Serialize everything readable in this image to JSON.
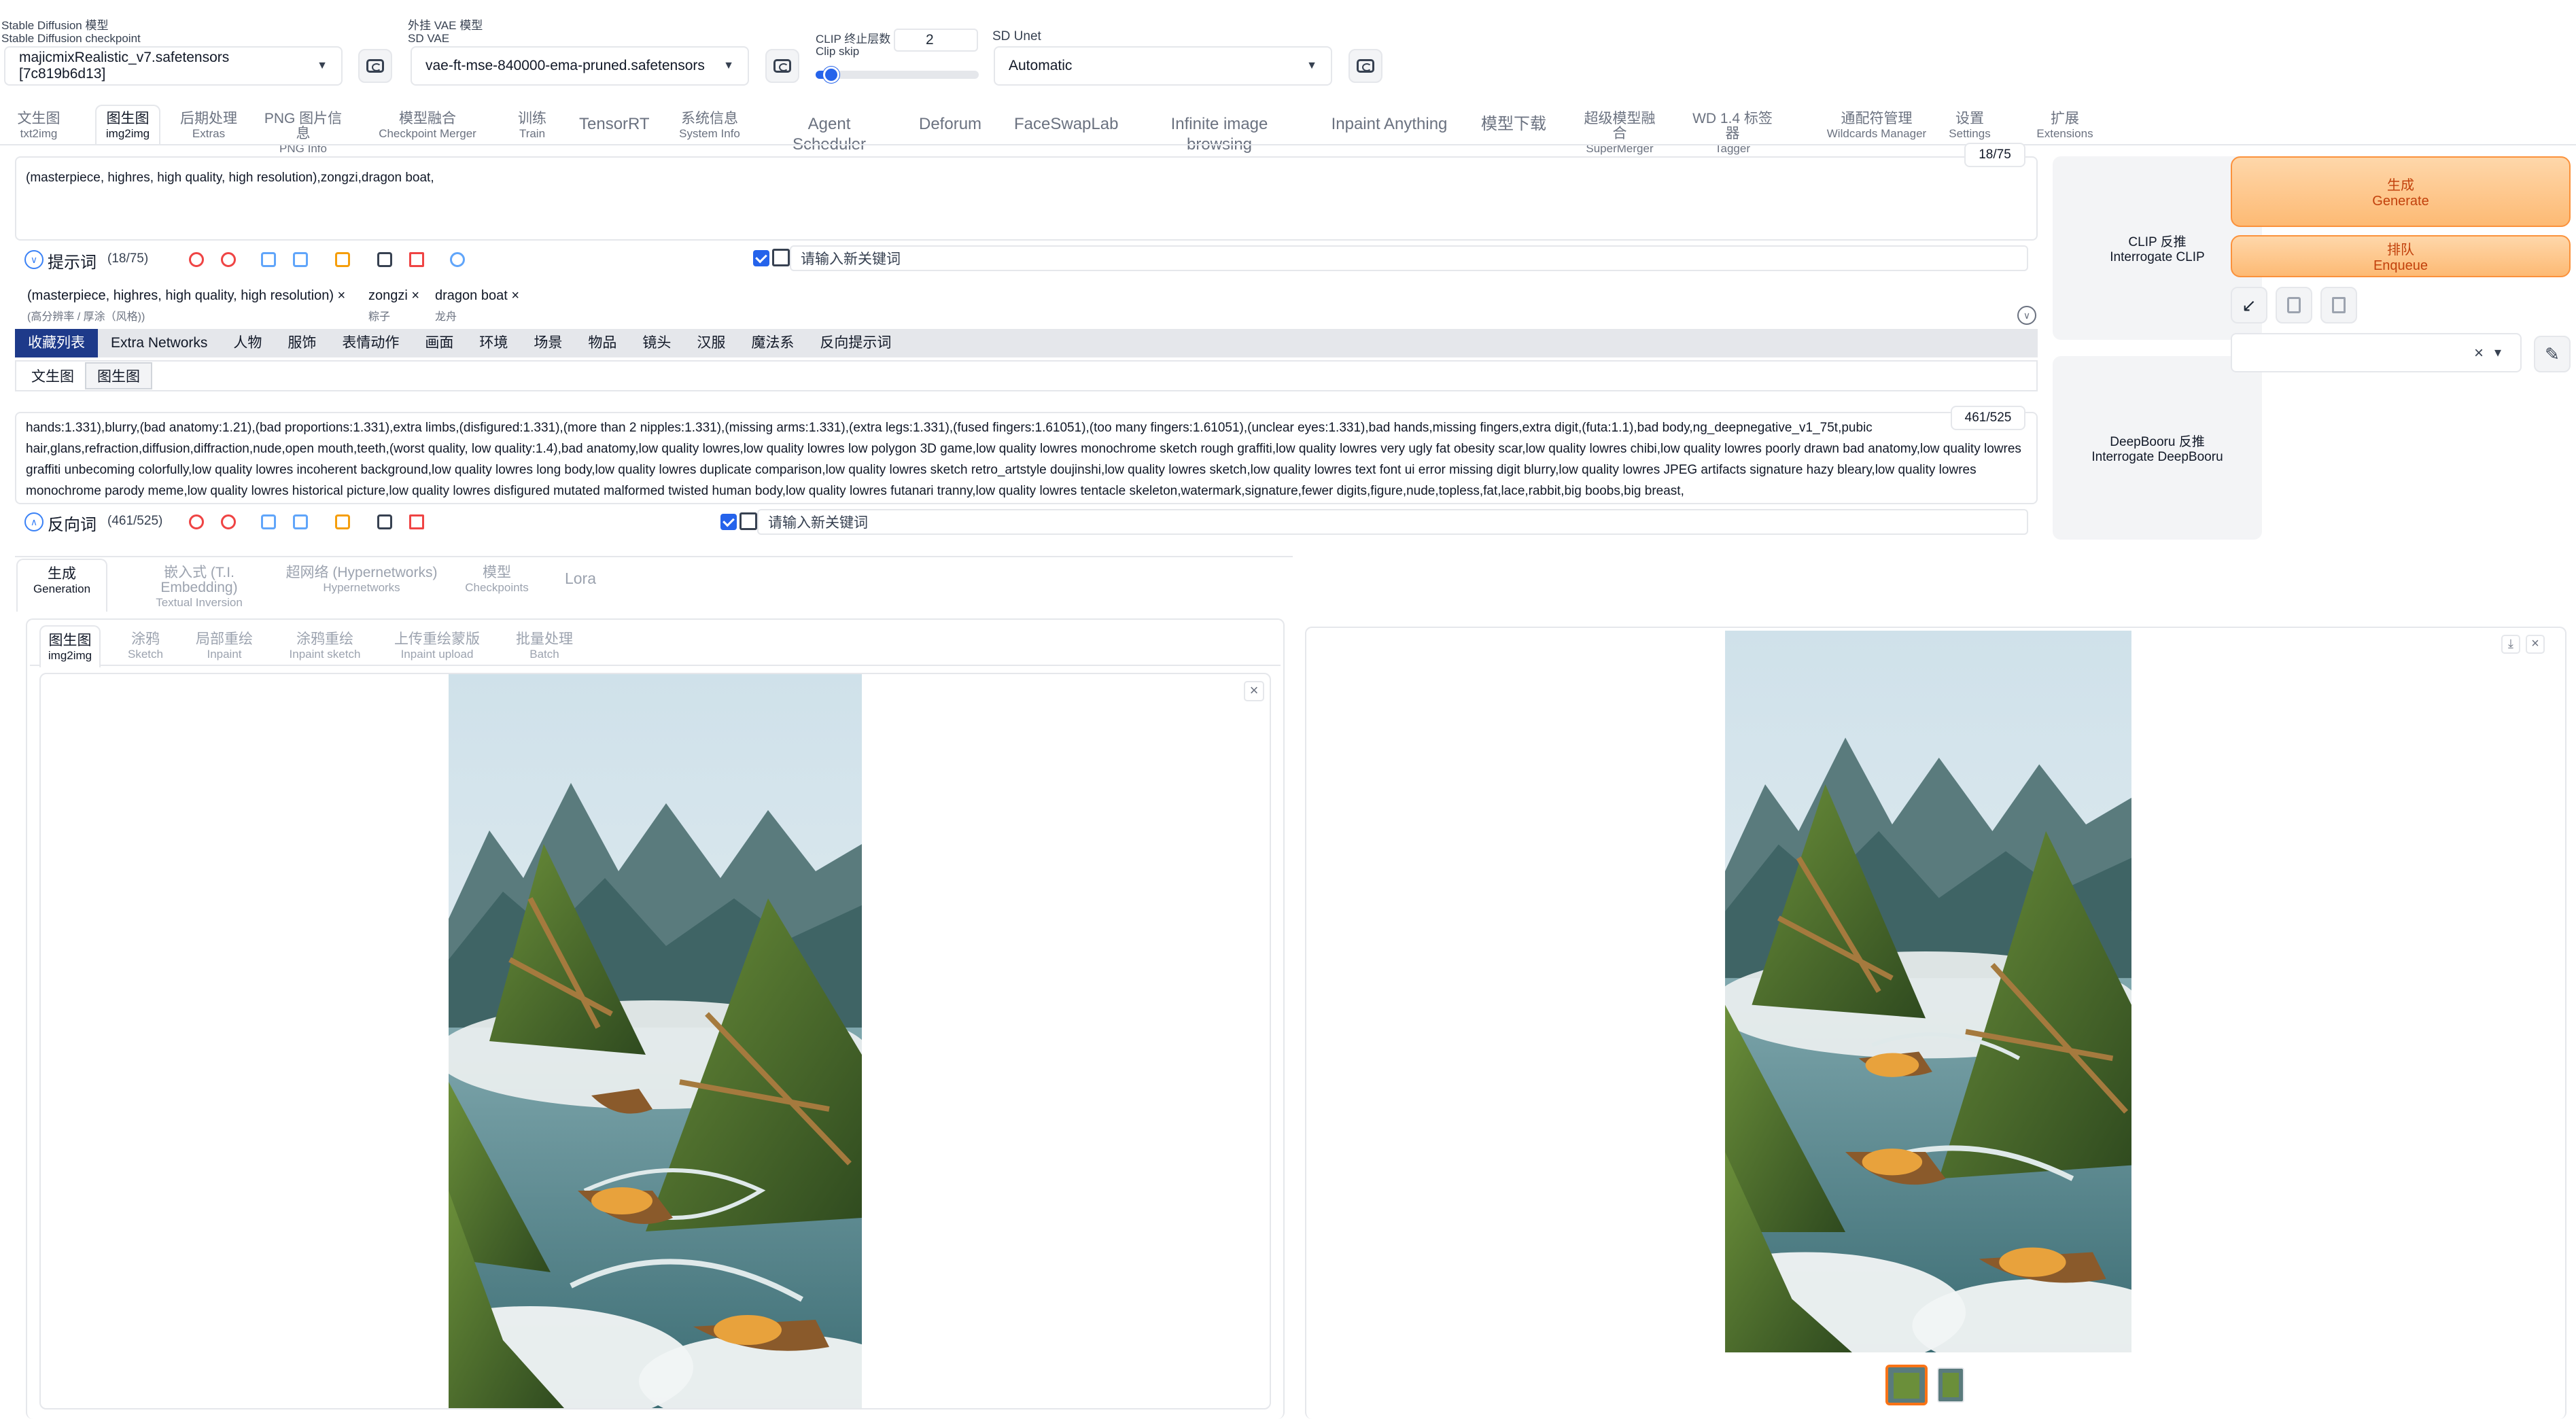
{
  "header": {
    "checkpoint": {
      "label_cn": "Stable Diffusion 模型",
      "label_en": "Stable Diffusion checkpoint",
      "value": "majicmixRealistic_v7.safetensors [7c819b6d13]"
    },
    "vae": {
      "label_cn": "外挂 VAE 模型",
      "label_en": "SD VAE",
      "value": "vae-ft-mse-840000-ema-pruned.safetensors"
    },
    "clip": {
      "label_cn": "CLIP 终止层数",
      "label_en": "Clip skip",
      "value": "2",
      "slider_fraction": 0.08
    },
    "unet": {
      "label": "SD Unet",
      "value": "Automatic"
    }
  },
  "tabs": [
    {
      "cn": "文生图",
      "en": "txt2img"
    },
    {
      "cn": "图生图",
      "en": "img2img"
    },
    {
      "cn": "后期处理",
      "en": "Extras"
    },
    {
      "cn": "PNG 图片信息",
      "en": "PNG Info"
    },
    {
      "cn": "模型融合",
      "en": "Checkpoint Merger"
    },
    {
      "cn": "训练",
      "en": "Train"
    },
    {
      "single": "TensorRT"
    },
    {
      "cn": "系统信息",
      "en": "System Info"
    },
    {
      "single": "Agent Scheduler"
    },
    {
      "single": "Deforum"
    },
    {
      "single": "FaceSwapLab"
    },
    {
      "single": "Infinite image browsing"
    },
    {
      "single": "Inpaint Anything"
    },
    {
      "single": "模型下载"
    },
    {
      "cn": "超级模型融合",
      "en": "SuperMerger"
    },
    {
      "cn": "WD 1.4 标签器",
      "en": "Tagger"
    },
    {
      "cn": "通配符管理",
      "en": "Wildcards Manager"
    },
    {
      "cn": "设置",
      "en": "Settings"
    },
    {
      "cn": "扩展",
      "en": "Extensions"
    }
  ],
  "prompt": {
    "text": "(masterpiece, highres, high quality, high resolution),zongzi,dragon boat,",
    "counter": "18/75",
    "label": "提示词",
    "count": "(18/75)",
    "keyword_placeholder": "请输入新关键词",
    "tags": [
      {
        "text": "(masterpiece, highres, high quality, high resolution)",
        "sub": "(高分辨率 / 厚涂（风格))"
      },
      {
        "text": "zongzi",
        "sub": "粽子"
      },
      {
        "text": "dragon boat",
        "sub": "龙舟"
      }
    ],
    "close_glyph": "×"
  },
  "categories": [
    "收藏列表",
    "Extra Networks",
    "人物",
    "服饰",
    "表情动作",
    "画面",
    "环境",
    "场景",
    "物品",
    "镜头",
    "汉服",
    "魔法系",
    "反向提示词"
  ],
  "subcategories": [
    "文生图",
    "图生图"
  ],
  "negative": {
    "text": "hands:1.331),blurry,(bad anatomy:1.21),(bad proportions:1.331),extra limbs,(disfigured:1.331),(more than 2 nipples:1.331),(missing arms:1.331),(extra legs:1.331),(fused fingers:1.61051),(too many fingers:1.61051),(unclear eyes:1.331),bad hands,missing fingers,extra digit,(futa:1.1),bad body,ng_deepnegative_v1_75t,pubic hair,glans,refraction,diffusion,diffraction,nude,open mouth,teeth,(worst quality, low quality:1.4),bad anatomy,low quality lowres,low quality lowres low polygon 3D game,low quality lowres monochrome sketch rough graffiti,low quality lowres very ugly fat obesity scar,low quality lowres chibi,low quality lowres poorly drawn bad anatomy,low quality lowres graffiti unbecoming colorfully,low quality lowres incoherent background,low quality lowres long body,low quality lowres duplicate comparison,low quality lowres sketch retro_artstyle doujinshi,low quality lowres sketch,low quality lowres text font ui error missing digit blurry,low quality lowres JPEG artifacts signature hazy bleary,low quality lowres monochrome parody meme,low quality lowres historical picture,low quality lowres disfigured mutated malformed twisted human body,low quality lowres futanari tranny,low quality lowres tentacle skeleton,watermark,signature,fewer digits,figure,nude,topless,fat,lace,rabbit,big boobs,big breast,",
    "counter": "461/525",
    "label": "反向词",
    "count": "(461/525)",
    "keyword_placeholder": "请输入新关键词"
  },
  "side": {
    "clip_cn": "CLIP 反推",
    "clip_en": "Interrogate CLIP",
    "deepbooru_cn": "DeepBooru 反推",
    "deepbooru_en": "Interrogate DeepBooru",
    "generate_cn": "生成",
    "generate_en": "Generate",
    "enqueue_cn": "排队",
    "enqueue_en": "Enqueue",
    "clear_glyph": "×",
    "dropdown_glyph": "▾"
  },
  "settings_tabs": [
    {
      "cn": "生成",
      "en": "Generation"
    },
    {
      "cn": "嵌入式 (T.I. Embedding)",
      "en": "Textual Inversion"
    },
    {
      "cn": "超网络 (Hypernetworks)",
      "en": "Hypernetworks"
    },
    {
      "cn": "模型",
      "en": "Checkpoints"
    },
    {
      "single": "Lora"
    }
  ],
  "mode_tabs": [
    {
      "cn": "图生图",
      "en": "img2img"
    },
    {
      "cn": "涂鸦",
      "en": "Sketch"
    },
    {
      "cn": "局部重绘",
      "en": "Inpaint"
    },
    {
      "cn": "涂鸦重绘",
      "en": "Inpaint sketch"
    },
    {
      "cn": "上传重绘蒙版",
      "en": "Inpaint upload"
    },
    {
      "cn": "批量处理",
      "en": "Batch"
    }
  ],
  "canvas_close_glyph": "×",
  "output_close_glyph": "×",
  "download_glyph": "⤓",
  "colors": {
    "accent_blue": "#1e3a8a",
    "generate_orange": "#fdba74",
    "check_blue": "#2563eb"
  }
}
